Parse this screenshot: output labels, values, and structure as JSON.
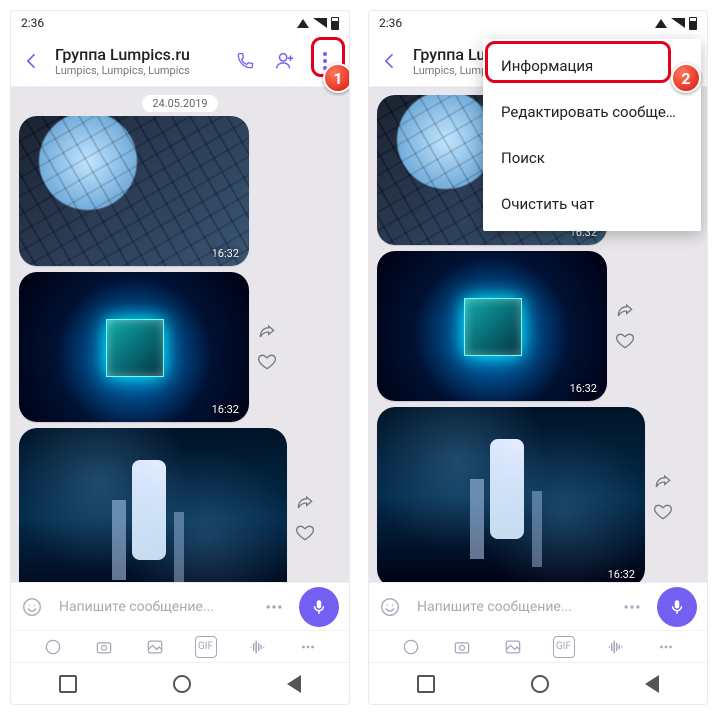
{
  "status": {
    "time": "2:36"
  },
  "header": {
    "title": "Группа Lumpics.ru",
    "subtitle": "Lumpics, Lumpics, Lumpics"
  },
  "chat": {
    "date_pill": "24.05.2019",
    "messages": [
      {
        "time": "16:32"
      },
      {
        "time": "16:32"
      },
      {
        "time": "16:32"
      }
    ]
  },
  "composer": {
    "placeholder": "Напишите сообщение..."
  },
  "menu": {
    "items": [
      "Информация",
      "Редактировать сообщения",
      "Поиск",
      "Очистить чат"
    ]
  },
  "callouts": {
    "one": "1",
    "two": "2"
  },
  "header_trunc": "Группа Lu"
}
